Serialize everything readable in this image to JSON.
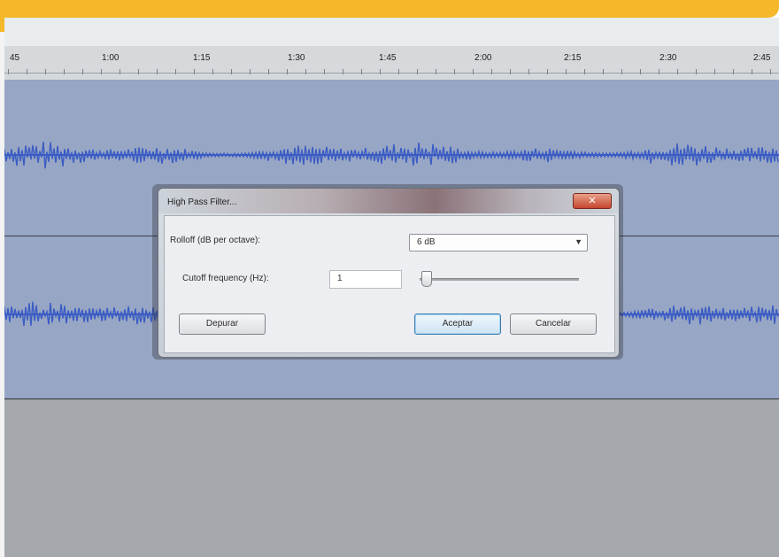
{
  "ruler": {
    "labels": [
      "45",
      "1:00",
      "1:15",
      "1:30",
      "1:45",
      "2:00",
      "2:15",
      "2:30",
      "2:45"
    ]
  },
  "dialog": {
    "title": "High Pass Filter...",
    "close_label": "✕",
    "rolloff_label": "Rolloff (dB per octave):",
    "rolloff_value": "6 dB",
    "cutoff_label": "Cutoff frequency (Hz):",
    "cutoff_value": "1",
    "cutoff_slider_fraction": 0.03,
    "debug_button": "Depurar",
    "ok_button": "Aceptar",
    "cancel_button": "Cancelar"
  },
  "colors": {
    "banner": "#f5b82a",
    "track_bg": "#97a6c4",
    "waveform": "#3b5cc4",
    "empty_area": "#a5a9ae"
  }
}
